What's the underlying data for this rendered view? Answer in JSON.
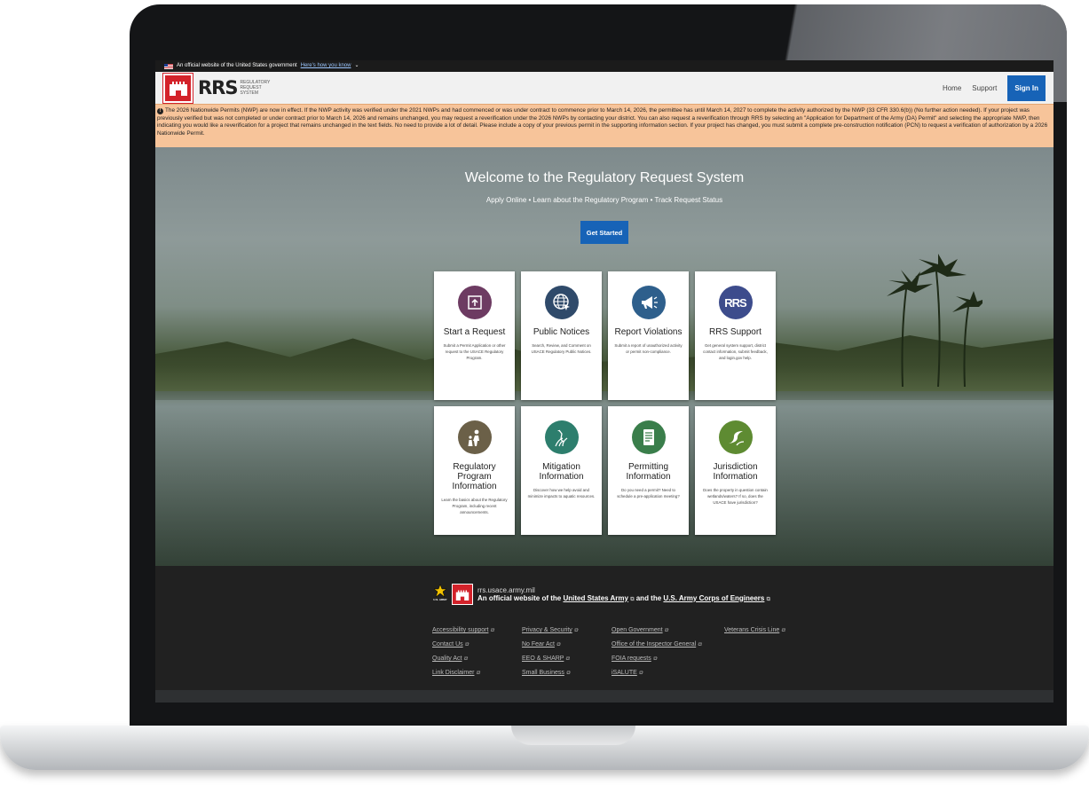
{
  "gov_banner": {
    "text": "An official website of the United States government",
    "link": "Here's how you know",
    "chevron": "⌄"
  },
  "header": {
    "logo": "RRS",
    "logo_sub": "REGULATORY REQUEST SYSTEM",
    "nav": {
      "home": "Home",
      "support": "Support",
      "sign_in": "Sign In"
    }
  },
  "alert": {
    "icon": "!",
    "text": "The 2026 Nationwide Permits (NWP) are now in effect. If the NWP activity was verified under the 2021 NWPs and had commenced or was under contract to commence prior to March 14, 2026, the permittee has until March 14, 2027 to complete the activity authorized by the NWP (33 CFR 330.6(b)) (No further action needed). If your project was previously verified but was not completed or under contract prior to March 14, 2026 and remains unchanged, you may request a reverification under the 2026 NWPs by contacting your district. You can also request a reverification through RRS by selecting an \"Application for Department of the Army (DA) Permit\" and selecting the appropriate NWP, then indicating you would like a reverification for a project that remains unchanged in the text fields. No need to provide a lot of detail. Please include a copy of your previous permit in the supporting information section. If your project has changed, you must submit a complete pre-construction notification (PCN) to request a verification of authorization by a 2026 Nationwide Permit."
  },
  "hero": {
    "title": "Welcome to the Regulatory Request System",
    "subtitle": "Apply Online • Learn about the Regulatory Program • Track Request Status",
    "cta": "Get Started"
  },
  "cards": [
    {
      "title": "Start a Request",
      "desc": "Submit a Permit Application or other request to the USACE Regulatory Program.",
      "icon": "upload-icon",
      "color": "#6d3b62"
    },
    {
      "title": "Public Notices",
      "desc": "Search, Review, and Comment on USACE Regulatory Public Notices.",
      "icon": "globe-cursor-icon",
      "color": "#2f4a6a"
    },
    {
      "title": "Report Violations",
      "desc": "Submit a report of unauthorized activity or permit non-compliance.",
      "icon": "megaphone-icon",
      "color": "#2e5f8c"
    },
    {
      "title": "RRS Support",
      "desc": "Get general system support, district contact information, submit feedback, and login.gov help.",
      "icon": "rrs-icon",
      "color": "#3d4c8c",
      "glyph": "RRS"
    },
    {
      "title": "Regulatory Program Information",
      "desc": "Learn the basics about the Regulatory Program, including recent announcements.",
      "icon": "people-icon",
      "color": "#6b6048"
    },
    {
      "title": "Mitigation Information",
      "desc": "Discover how we help avoid and minimize impacts to aquatic resources.",
      "icon": "bird-plant-icon",
      "color": "#2d7e6d"
    },
    {
      "title": "Permitting Information",
      "desc": "Do you need a permit? Need to schedule a pre-application meeting?",
      "icon": "document-icon",
      "color": "#3a7e4b"
    },
    {
      "title": "Jurisdiction Information",
      "desc": "Does the property in question contain wetlands/waters? If so, does the USACE have jurisdiction?",
      "icon": "landscape-icon",
      "color": "#5e8b32"
    }
  ],
  "footer": {
    "domain": "rrs.usace.army.mil",
    "army_label": "U.S. ARMY",
    "official_pre": "An official website of the",
    "army_link": "United States Army",
    "and": "and the",
    "corps_link": "U.S. Army Corps of Engineers",
    "ext_glyph": "⧉",
    "links": [
      "Accessibility support",
      "Privacy & Security",
      "Open Government",
      "Veterans Crisis Line",
      "Contact Us",
      "No Fear Act",
      "Office of the Inspector General",
      "",
      "Quality Act",
      "EEO & SHARP",
      "FOIA requests",
      "",
      "Link Disclaimer",
      "Small Business",
      "iSALUTE",
      ""
    ]
  }
}
